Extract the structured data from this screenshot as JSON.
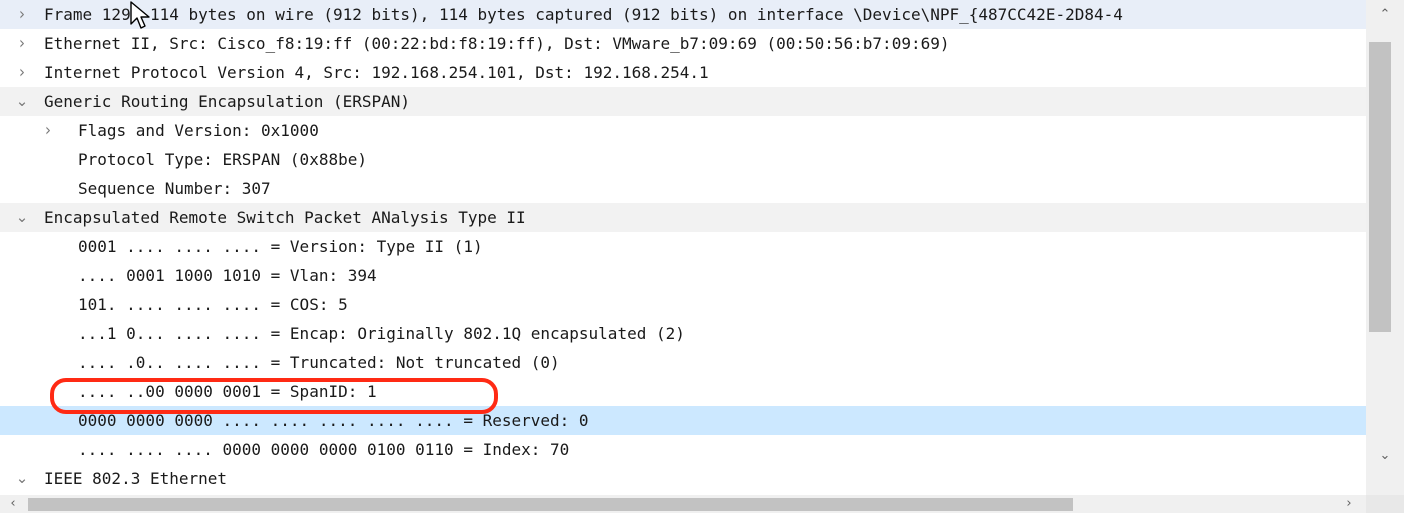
{
  "tree": [
    {
      "name": "row-frame",
      "arrow": "collapsed",
      "text": "Frame 129: 114 bytes on wire (912 bits), 114 bytes captured (912 bits) on interface \\Device\\NPF_{487CC42E-2D84-4"
    },
    {
      "name": "row-ethernet",
      "arrow": "collapsed",
      "text": "Ethernet II, Src: Cisco_f8:19:ff (00:22:bd:f8:19:ff), Dst: VMware_b7:09:69 (00:50:56:b7:09:69)"
    },
    {
      "name": "row-ipv4",
      "arrow": "collapsed",
      "text": "Internet Protocol Version 4, Src: 192.168.254.101, Dst: 192.168.254.1"
    },
    {
      "name": "row-gre",
      "arrow": "expanded",
      "text": "Generic Routing Encapsulation (ERSPAN)"
    },
    {
      "name": "row-flags-version",
      "arrow": "collapsed",
      "text": "Flags and Version: 0x1000"
    },
    {
      "name": "row-protocol-type",
      "arrow": "",
      "text": "Protocol Type: ERSPAN (0x88be)"
    },
    {
      "name": "row-sequence-number",
      "arrow": "",
      "text": "Sequence Number: 307"
    },
    {
      "name": "row-erspan",
      "arrow": "expanded",
      "text": "Encapsulated Remote Switch Packet ANalysis Type II"
    },
    {
      "name": "row-version",
      "arrow": "",
      "text": "0001 .... .... .... = Version: Type II (1)"
    },
    {
      "name": "row-vlan",
      "arrow": "",
      "text": ".... 0001 1000 1010 = Vlan: 394"
    },
    {
      "name": "row-cos",
      "arrow": "",
      "text": "101. .... .... .... = COS: 5"
    },
    {
      "name": "row-encap",
      "arrow": "",
      "text": "...1 0... .... .... = Encap: Originally 802.1Q encapsulated (2)"
    },
    {
      "name": "row-truncated",
      "arrow": "",
      "text": ".... .0.. .... .... = Truncated: Not truncated (0)"
    },
    {
      "name": "row-spanid",
      "arrow": "",
      "text": ".... ..00 0000 0001 = SpanID: 1"
    },
    {
      "name": "row-reserved",
      "arrow": "",
      "text": "0000 0000 0000 .... .... .... .... .... = Reserved: 0"
    },
    {
      "name": "row-index",
      "arrow": "",
      "text": ".... .... .... 0000 0000 0000 0100 0110 = Index: 70"
    },
    {
      "name": "row-ieee8023",
      "arrow": "expanded",
      "text": "IEEE 802.3 Ethernet"
    }
  ],
  "icons": {
    "collapsed": "›",
    "expanded": "⌄",
    "scroll_up": "⌃",
    "scroll_down": "⌄",
    "scroll_left": "‹",
    "scroll_right": "›"
  },
  "colors": {
    "selected_row": "#cce8ff",
    "annotation": "#ff2a14"
  }
}
